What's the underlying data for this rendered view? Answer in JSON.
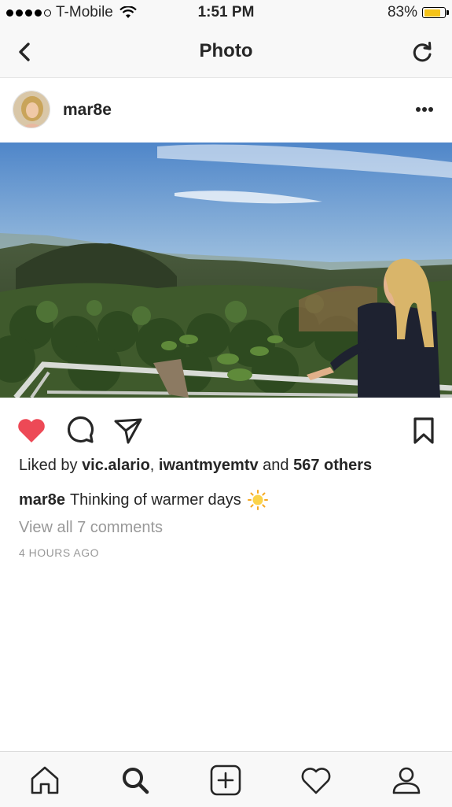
{
  "status_bar": {
    "carrier": "T-Mobile",
    "time": "1:51 PM",
    "battery_percent": "83%",
    "battery_level": 0.83,
    "battery_color": "#f5c318",
    "signal_dots_filled": 4,
    "signal_dots_total": 5
  },
  "nav": {
    "title": "Photo",
    "back_icon": "chevron-left-icon",
    "refresh_icon": "refresh-icon"
  },
  "post": {
    "username": "mar8e",
    "more_icon": "ellipsis-icon",
    "likes": {
      "prefix": "Liked by ",
      "user1": "vic.alario",
      "sep1": ", ",
      "user2": "iwantmyemtv",
      "sep2": " and ",
      "others": "567 others"
    },
    "caption_user": "mar8e",
    "caption_text": "Thinking of warmer days",
    "view_comments": "View all 7 comments",
    "timestamp": "4 HOURS AGO",
    "liked": true,
    "like_color": "#ed4956"
  },
  "tab_bar": {
    "items": [
      "home-icon",
      "search-icon",
      "add-post-icon",
      "activity-heart-icon",
      "profile-icon"
    ],
    "active": "search-icon"
  }
}
